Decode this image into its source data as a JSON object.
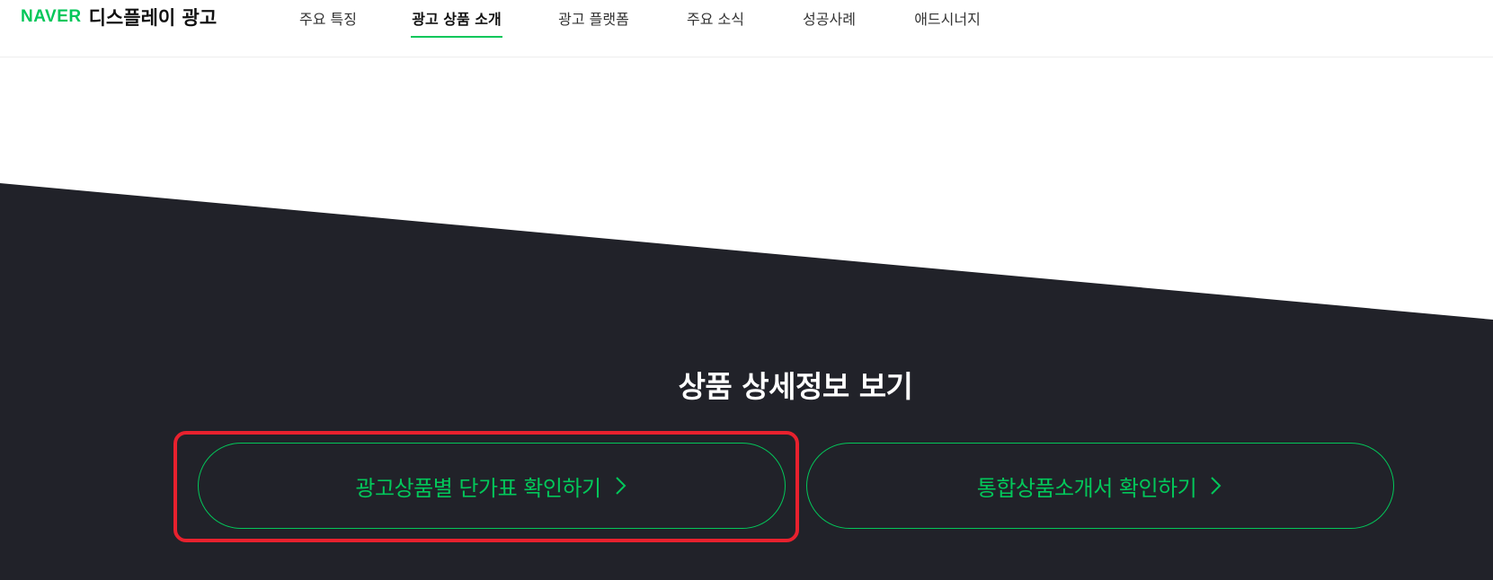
{
  "header": {
    "logo_brand": "NAVER",
    "logo_service": "디스플레이 광고",
    "nav": [
      {
        "label": "주요 특징",
        "active": false
      },
      {
        "label": "광고 상품 소개",
        "active": true
      },
      {
        "label": "광고 플랫폼",
        "active": false
      },
      {
        "label": "주요 소식",
        "active": false
      },
      {
        "label": "성공사례",
        "active": false
      },
      {
        "label": "애드시너지",
        "active": false
      }
    ]
  },
  "detail": {
    "title": "상품 상세정보 보기",
    "buttons": [
      {
        "label": "광고상품별 단가표 확인하기",
        "highlighted": true
      },
      {
        "label": "통합상품소개서 확인하기",
        "highlighted": false
      }
    ]
  },
  "colors": {
    "accent": "#03c75a",
    "dark_bg": "#212229",
    "highlight": "#e8212e",
    "header_bg": "#ffffff"
  }
}
